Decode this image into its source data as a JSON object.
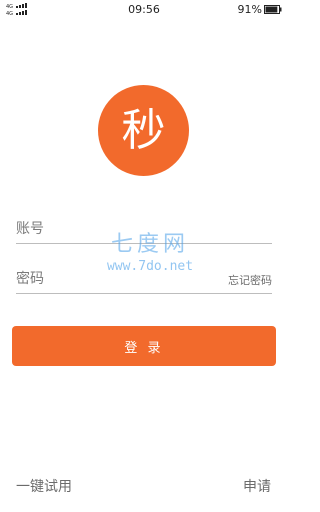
{
  "status_bar": {
    "signal_text": "4G 4G",
    "time": "09:56",
    "battery_percent": "91%",
    "battery_level": 0.91,
    "icons": [
      "signal-icon",
      "battery-icon"
    ]
  },
  "logo": {
    "character": "秒",
    "color": "#f26a2c"
  },
  "form": {
    "account_placeholder": "账号",
    "password_placeholder": "密码",
    "forgot_password": "忘记密码",
    "login_button": "登 录"
  },
  "watermark": {
    "text": "七度网",
    "url": "www.7do.net",
    "color": "#4a9fe8"
  },
  "footer": {
    "trial": "一键试用",
    "apply": "申请"
  },
  "colors": {
    "accent": "#f26a2c",
    "text_secondary": "#6b6b6b",
    "divider": "#bdbdbd"
  }
}
